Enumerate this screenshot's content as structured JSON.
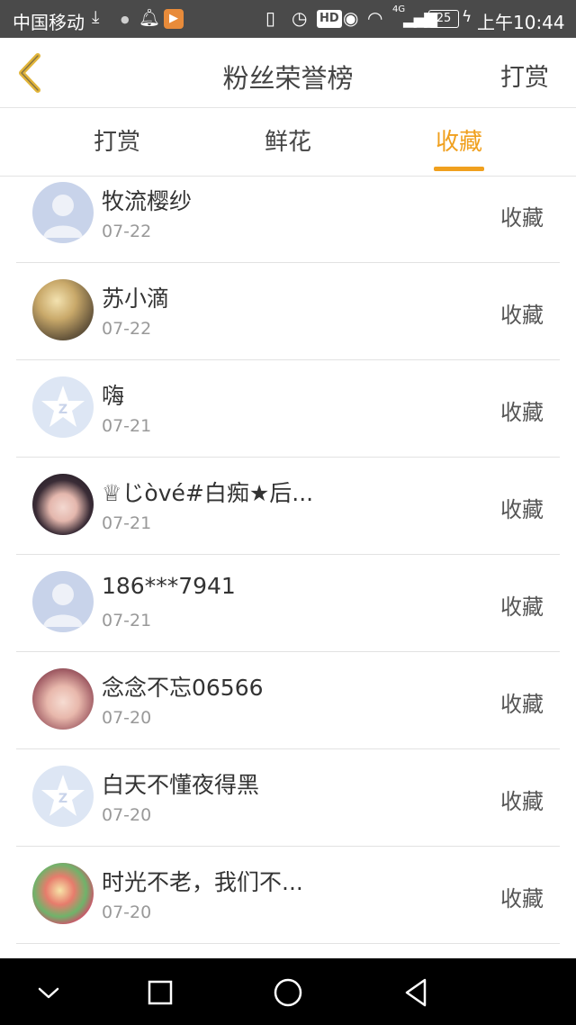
{
  "status_bar": {
    "carrier": "中国移动",
    "network_label": "4G",
    "hd_label": "HD",
    "battery": "25",
    "time": "上午10:44",
    "icons": [
      "download-icon",
      "bell-icon",
      "video-app-icon",
      "vibrate-icon",
      "alarm-icon",
      "hd-icon",
      "eye-icon",
      "wifi-icon",
      "signal-icon",
      "battery-icon",
      "charging-icon"
    ]
  },
  "header": {
    "title": "粉丝荣誉榜",
    "right_action": "打赏",
    "back_icon": "chevron-left-icon"
  },
  "tabs": {
    "items": [
      {
        "label": "打赏"
      },
      {
        "label": "鲜花"
      },
      {
        "label": "收藏"
      }
    ],
    "active_index": 2
  },
  "colors": {
    "accent": "#f0a01e",
    "statusbar": "#4a4a4a",
    "text": "#333333",
    "subtext": "#999999",
    "navbar": "#000000"
  },
  "list": {
    "rows": [
      {
        "name": "牧流樱纱",
        "date": "07-22",
        "action": "收藏",
        "avatar": "default-user-avatar"
      },
      {
        "name": "苏小滴",
        "date": "07-22",
        "action": "收藏",
        "avatar": "anime-avatar"
      },
      {
        "name": "嗨",
        "date": "07-21",
        "action": "收藏",
        "avatar": "qq-avatar"
      },
      {
        "name": "♕じòvé#白痴★后...",
        "date": "07-21",
        "action": "收藏",
        "avatar": "photo-avatar"
      },
      {
        "name": "186***7941",
        "date": "07-21",
        "action": "收藏",
        "avatar": "default-user-avatar"
      },
      {
        "name": "念念不忘06566",
        "date": "07-20",
        "action": "收藏",
        "avatar": "photo-avatar"
      },
      {
        "name": "白天不懂夜得黑",
        "date": "07-20",
        "action": "收藏",
        "avatar": "qq-avatar"
      },
      {
        "name": "时光不老，我们不...",
        "date": "07-20",
        "action": "收藏",
        "avatar": "anime-avatar"
      }
    ]
  },
  "nav_bar": {
    "buttons": [
      "chevron-down-icon",
      "square-icon",
      "circle-icon",
      "triangle-back-icon"
    ]
  }
}
